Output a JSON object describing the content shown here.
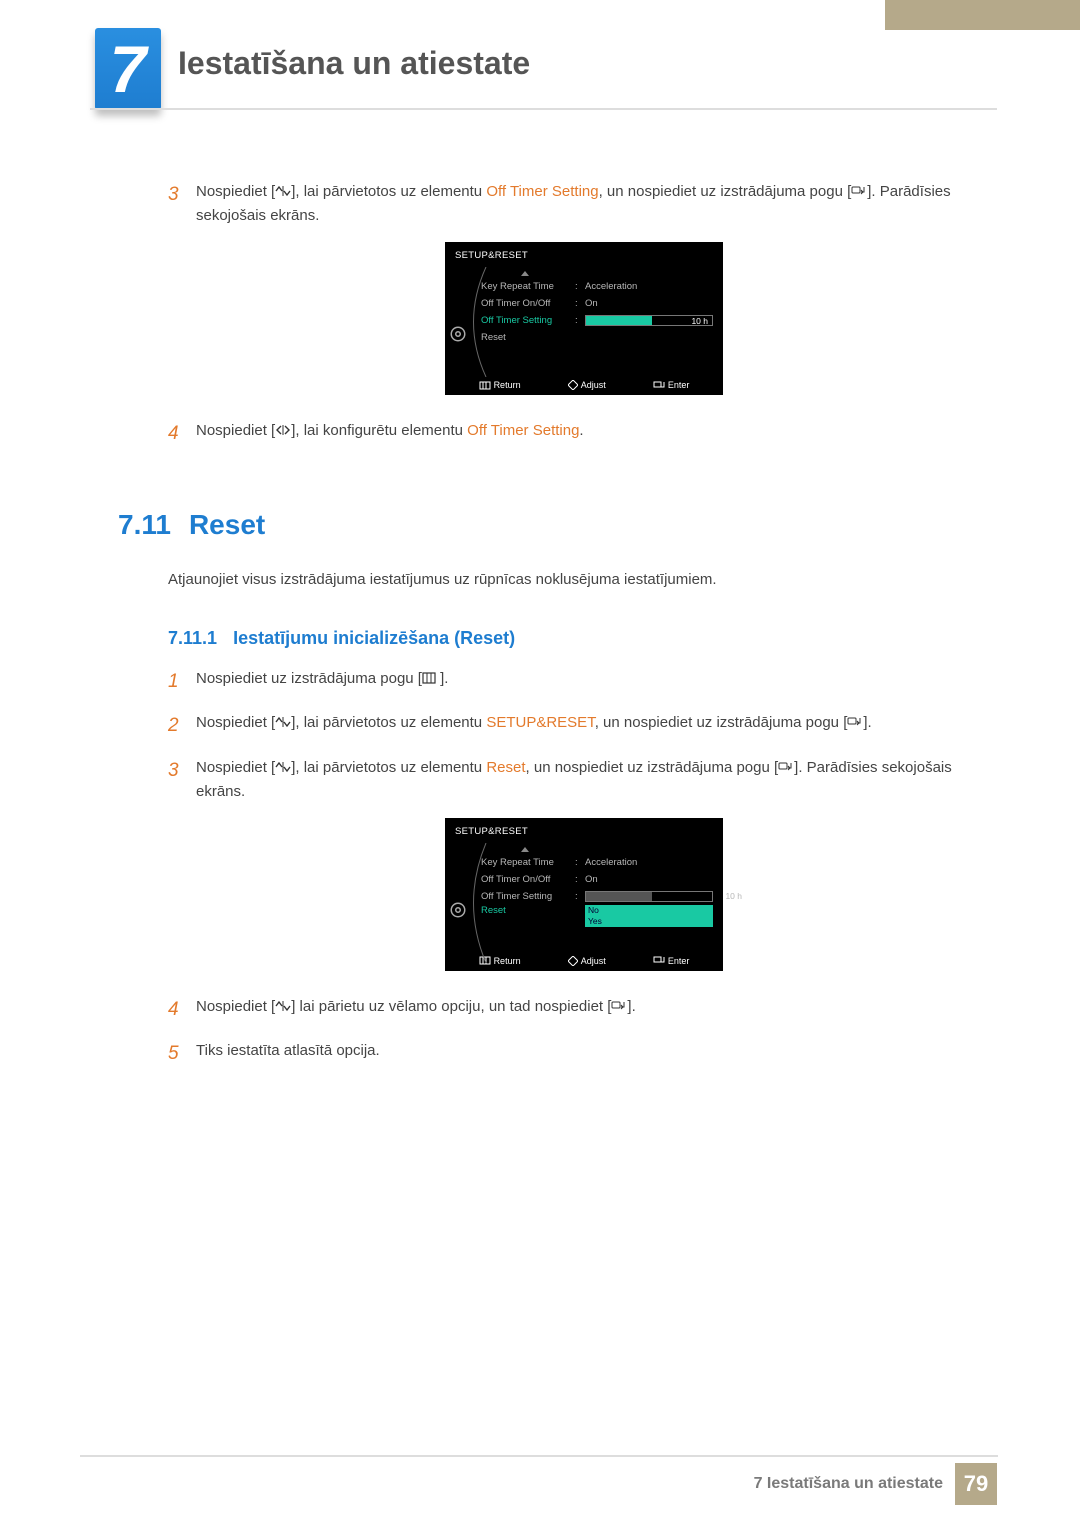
{
  "chapter": {
    "number": "7",
    "title": "Iestatīšana un atiestate"
  },
  "topsteps": {
    "3": {
      "before": "Nospiediet [",
      "mid1": "], lai pārvietotos uz elementu ",
      "link": "Off Timer Setting",
      "mid2": ", un nospiediet uz izstrādājuma pogu [",
      "after": "]. Parādīsies sekojošais ekrāns."
    },
    "4": {
      "before": "Nospiediet [",
      "mid1": "], lai konfigurētu elementu ",
      "link": "Off Timer Setting",
      "after": "."
    }
  },
  "section": {
    "num": "7.11",
    "title": "Reset",
    "desc": "Atjaunojiet visus izstrādājuma iestatījumus uz rūpnīcas noklusējuma iestatījumiem."
  },
  "subsection": {
    "num": "7.11.1",
    "title": "Iestatījumu inicializēšana (Reset)"
  },
  "steps": {
    "1": {
      "before": "Nospiediet uz izstrādājuma pogu [",
      "after": " ]."
    },
    "2": {
      "before": "Nospiediet [",
      "mid1": "], lai pārvietotos uz elementu ",
      "link": "SETUP&RESET",
      "mid2": ", un nospiediet uz izstrādājuma pogu [",
      "after": "]."
    },
    "3": {
      "before": "Nospiediet [",
      "mid1": "], lai pārvietotos uz elementu ",
      "link": "Reset",
      "mid2": ", un nospiediet uz izstrādājuma pogu [",
      "after": "]. Parādīsies sekojošais ekrāns."
    },
    "4": {
      "before": "Nospiediet [",
      "mid1": "] lai pārietu uz vēlamo opciju, un tad nospiediet [",
      "after": "]."
    },
    "5": {
      "text": "Tiks iestatīta atlasītā opcija."
    }
  },
  "osd1": {
    "title": "SETUP&RESET",
    "rows": {
      "krt": {
        "label": "Key Repeat Time",
        "value": "Acceleration"
      },
      "ot": {
        "label": "Off Timer On/Off",
        "value": "On"
      },
      "ots": {
        "label": "Off Timer Setting",
        "slider_value": "10 h",
        "slider_fill": 52
      },
      "rst": {
        "label": "Reset"
      }
    },
    "footer": {
      "return": "Return",
      "adjust": "Adjust",
      "enter": "Enter"
    }
  },
  "osd2": {
    "title": "SETUP&RESET",
    "rows": {
      "krt": {
        "label": "Key Repeat Time",
        "value": "Acceleration"
      },
      "ot": {
        "label": "Off Timer On/Off",
        "value": "On"
      },
      "ots": {
        "label": "Off Timer Setting",
        "slider_value": "10 h",
        "slider_fill": 52
      },
      "rst": {
        "label": "Reset",
        "opt1": "No",
        "opt2": "Yes"
      }
    },
    "footer": {
      "return": "Return",
      "adjust": "Adjust",
      "enter": "Enter"
    }
  },
  "footer": {
    "label": "7 Iestatīšana un atiestate",
    "page": "79"
  }
}
